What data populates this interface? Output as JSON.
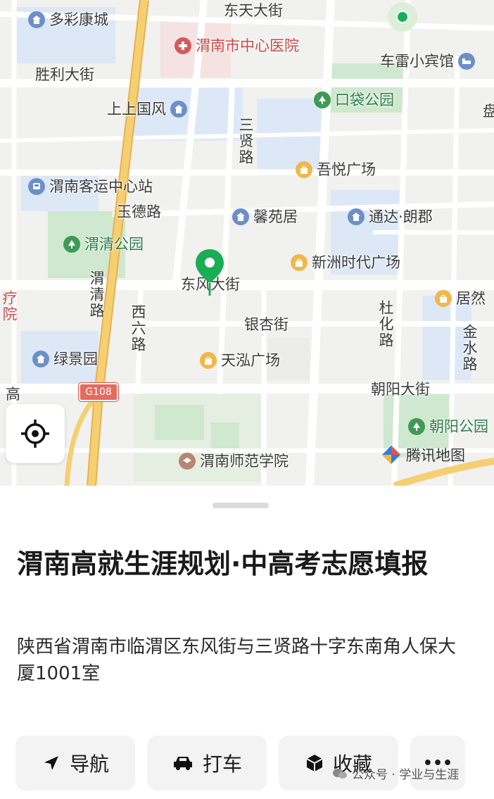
{
  "map": {
    "street_labels": {
      "dongtian": "东天大街",
      "shengli": "胜利大街",
      "yude": "玉德路",
      "dongfeng": "东风大街",
      "yinxing": "银杏街",
      "chaoyang": "朝阳大街",
      "gao": "高",
      "liao": "疗院",
      "sanxian": "三贤路",
      "weiqing": "渭清路",
      "xiliu": "西六路",
      "duhua": "杜化路",
      "jinshui": "金水路",
      "partial_right": "盘"
    },
    "pois": {
      "duocai": "多彩康城",
      "hospital": "渭南市中心医院",
      "chelei": "车雷小宾馆",
      "koudai": "口袋公园",
      "shangshang": "上上国风",
      "wuyue": "吾悦广场",
      "keyun": "渭南客运中心站",
      "xinyuan": "馨苑居",
      "tongda": "通达·朗郡",
      "weiqing_park": "渭清公园",
      "xinzhou": "新洲时代广场",
      "juran": "居然",
      "lvjing": "绿景园",
      "tianhong": "天泓广场",
      "chaoyang_park": "朝阳公园",
      "normal_univ": "渭南师范学院"
    },
    "highway_shield": "G108",
    "provider_logo": "腾讯地图",
    "icons": {
      "pin": "location-pin-icon",
      "locate": "crosshair-locate-icon",
      "poi_home": "home-icon",
      "poi_park": "tree-icon",
      "poi_mall": "shopping-bag-icon",
      "poi_hospital": "hospital-icon",
      "poi_bus": "bus-icon",
      "poi_hotel": "bed-icon",
      "poi_school": "school-icon"
    }
  },
  "place": {
    "title": "渭南高就生涯规划·中高考志愿填报",
    "address": "陕西省渭南市临渭区东风街与三贤路十字东南角人保大厦1001室"
  },
  "actions": {
    "navigate": "导航",
    "taxi": "打车",
    "favorite": "收藏",
    "more": "•••"
  },
  "watermark": "公众号 · 学业与生涯",
  "colors": {
    "map_bg": "#f1f1ef",
    "road": "#ffffff",
    "water_block": "#dde8f7",
    "park": "#cfe8cf",
    "highway": "#f4c869",
    "pin": "#1aad55",
    "button_bg": "#f3f3f3"
  }
}
